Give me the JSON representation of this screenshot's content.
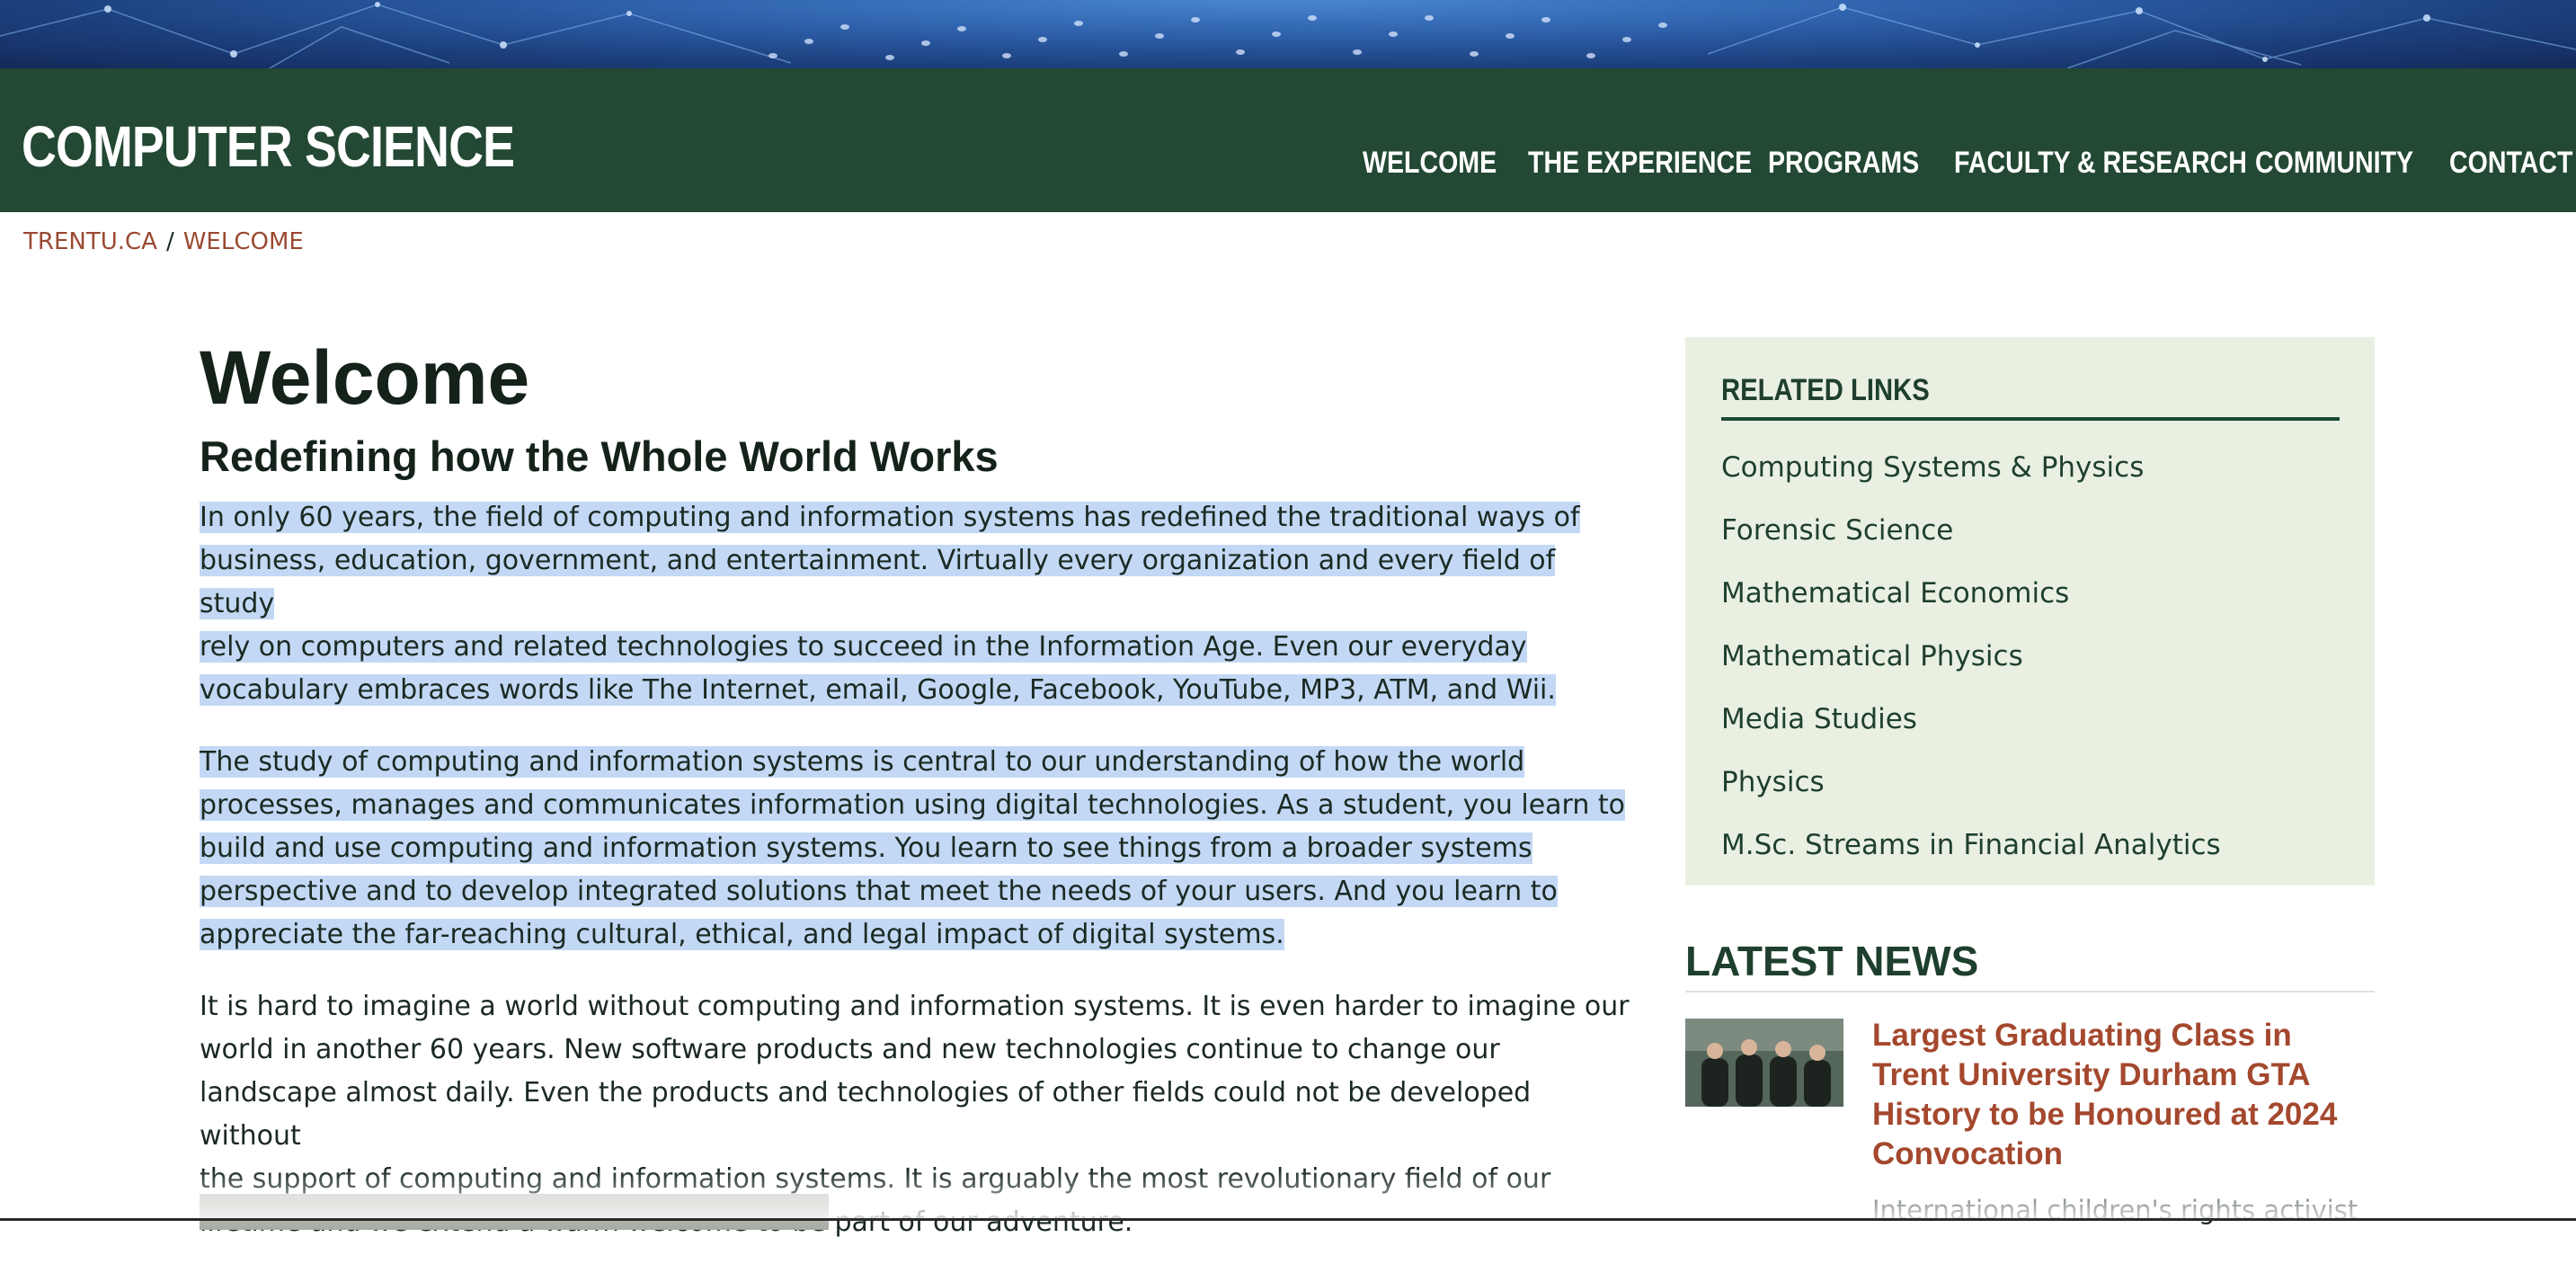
{
  "header": {
    "site_title": "COMPUTER SCIENCE",
    "nav": [
      {
        "label": "WELCOME"
      },
      {
        "label": "THE EXPERIENCE"
      },
      {
        "label": "PROGRAMS"
      },
      {
        "label": "FACULTY & RESEARCH"
      },
      {
        "label": "COMMUNITY"
      },
      {
        "label": "CONTACT"
      }
    ]
  },
  "breadcrumb": {
    "items": [
      {
        "label": "TRENTU.CA"
      },
      {
        "label": "WELCOME"
      }
    ],
    "separator": "/"
  },
  "main": {
    "title": "Welcome",
    "subtitle": "Redefining how the Whole World Works",
    "paragraphs": [
      {
        "lines": [
          "In only 60 years, the field of computing and information systems has redefined the traditional ways of",
          "business, education, government, and entertainment.  Virtually every organization and every field of study",
          "rely on computers and related technologies to succeed in the Information Age.  Even our everyday",
          "vocabulary embraces words like The Internet, email, Google, Facebook, YouTube, MP3, ATM, and Wii."
        ],
        "selected": true
      },
      {
        "lines": [
          "The study of computing and information systems is central to our understanding of how the world",
          "processes, manages and communicates information using digital technologies.  As a student, you learn to",
          "build and use computing and information systems.  You learn to see things from a broader systems",
          "perspective and to develop integrated solutions that meet the needs of your users.  And you learn to",
          "appreciate the far-reaching cultural, ethical, and legal impact of digital systems."
        ],
        "selected": true
      },
      {
        "lines": [
          "It is hard to imagine a world without computing and information systems.  It is even harder to imagine our",
          "world in another 60 years.  New software products and new technologies continue to change our",
          "landscape almost daily.  Even the products and technologies of other fields could not be developed without",
          "the support of computing and information systems.  It is arguably the most revolutionary field of our",
          "lifetime and we extend a warm welcome to be part of our adventure."
        ],
        "selected": false
      }
    ]
  },
  "sidebar": {
    "related_heading": "RELATED LINKS",
    "related_links": [
      {
        "label": "Computing Systems & Physics"
      },
      {
        "label": "Forensic Science"
      },
      {
        "label": "Mathematical Economics"
      },
      {
        "label": "Mathematical Physics"
      },
      {
        "label": "Media Studies"
      },
      {
        "label": "Physics"
      },
      {
        "label": "M.Sc. Streams in Financial Analytics"
      }
    ],
    "news_heading": "LATEST NEWS",
    "news": {
      "title": "Largest Graduating Class in Trent University Durham GTA History to be Honoured at 2024 Convocation",
      "snippet": "International children's rights activist",
      "thumbnail_icon": "graduates-photo"
    }
  },
  "colors": {
    "header_green": "#234834",
    "link_rust": "#a4482e",
    "sidebar_bg": "#e9f0e2",
    "selection": "#c3d8f5"
  }
}
